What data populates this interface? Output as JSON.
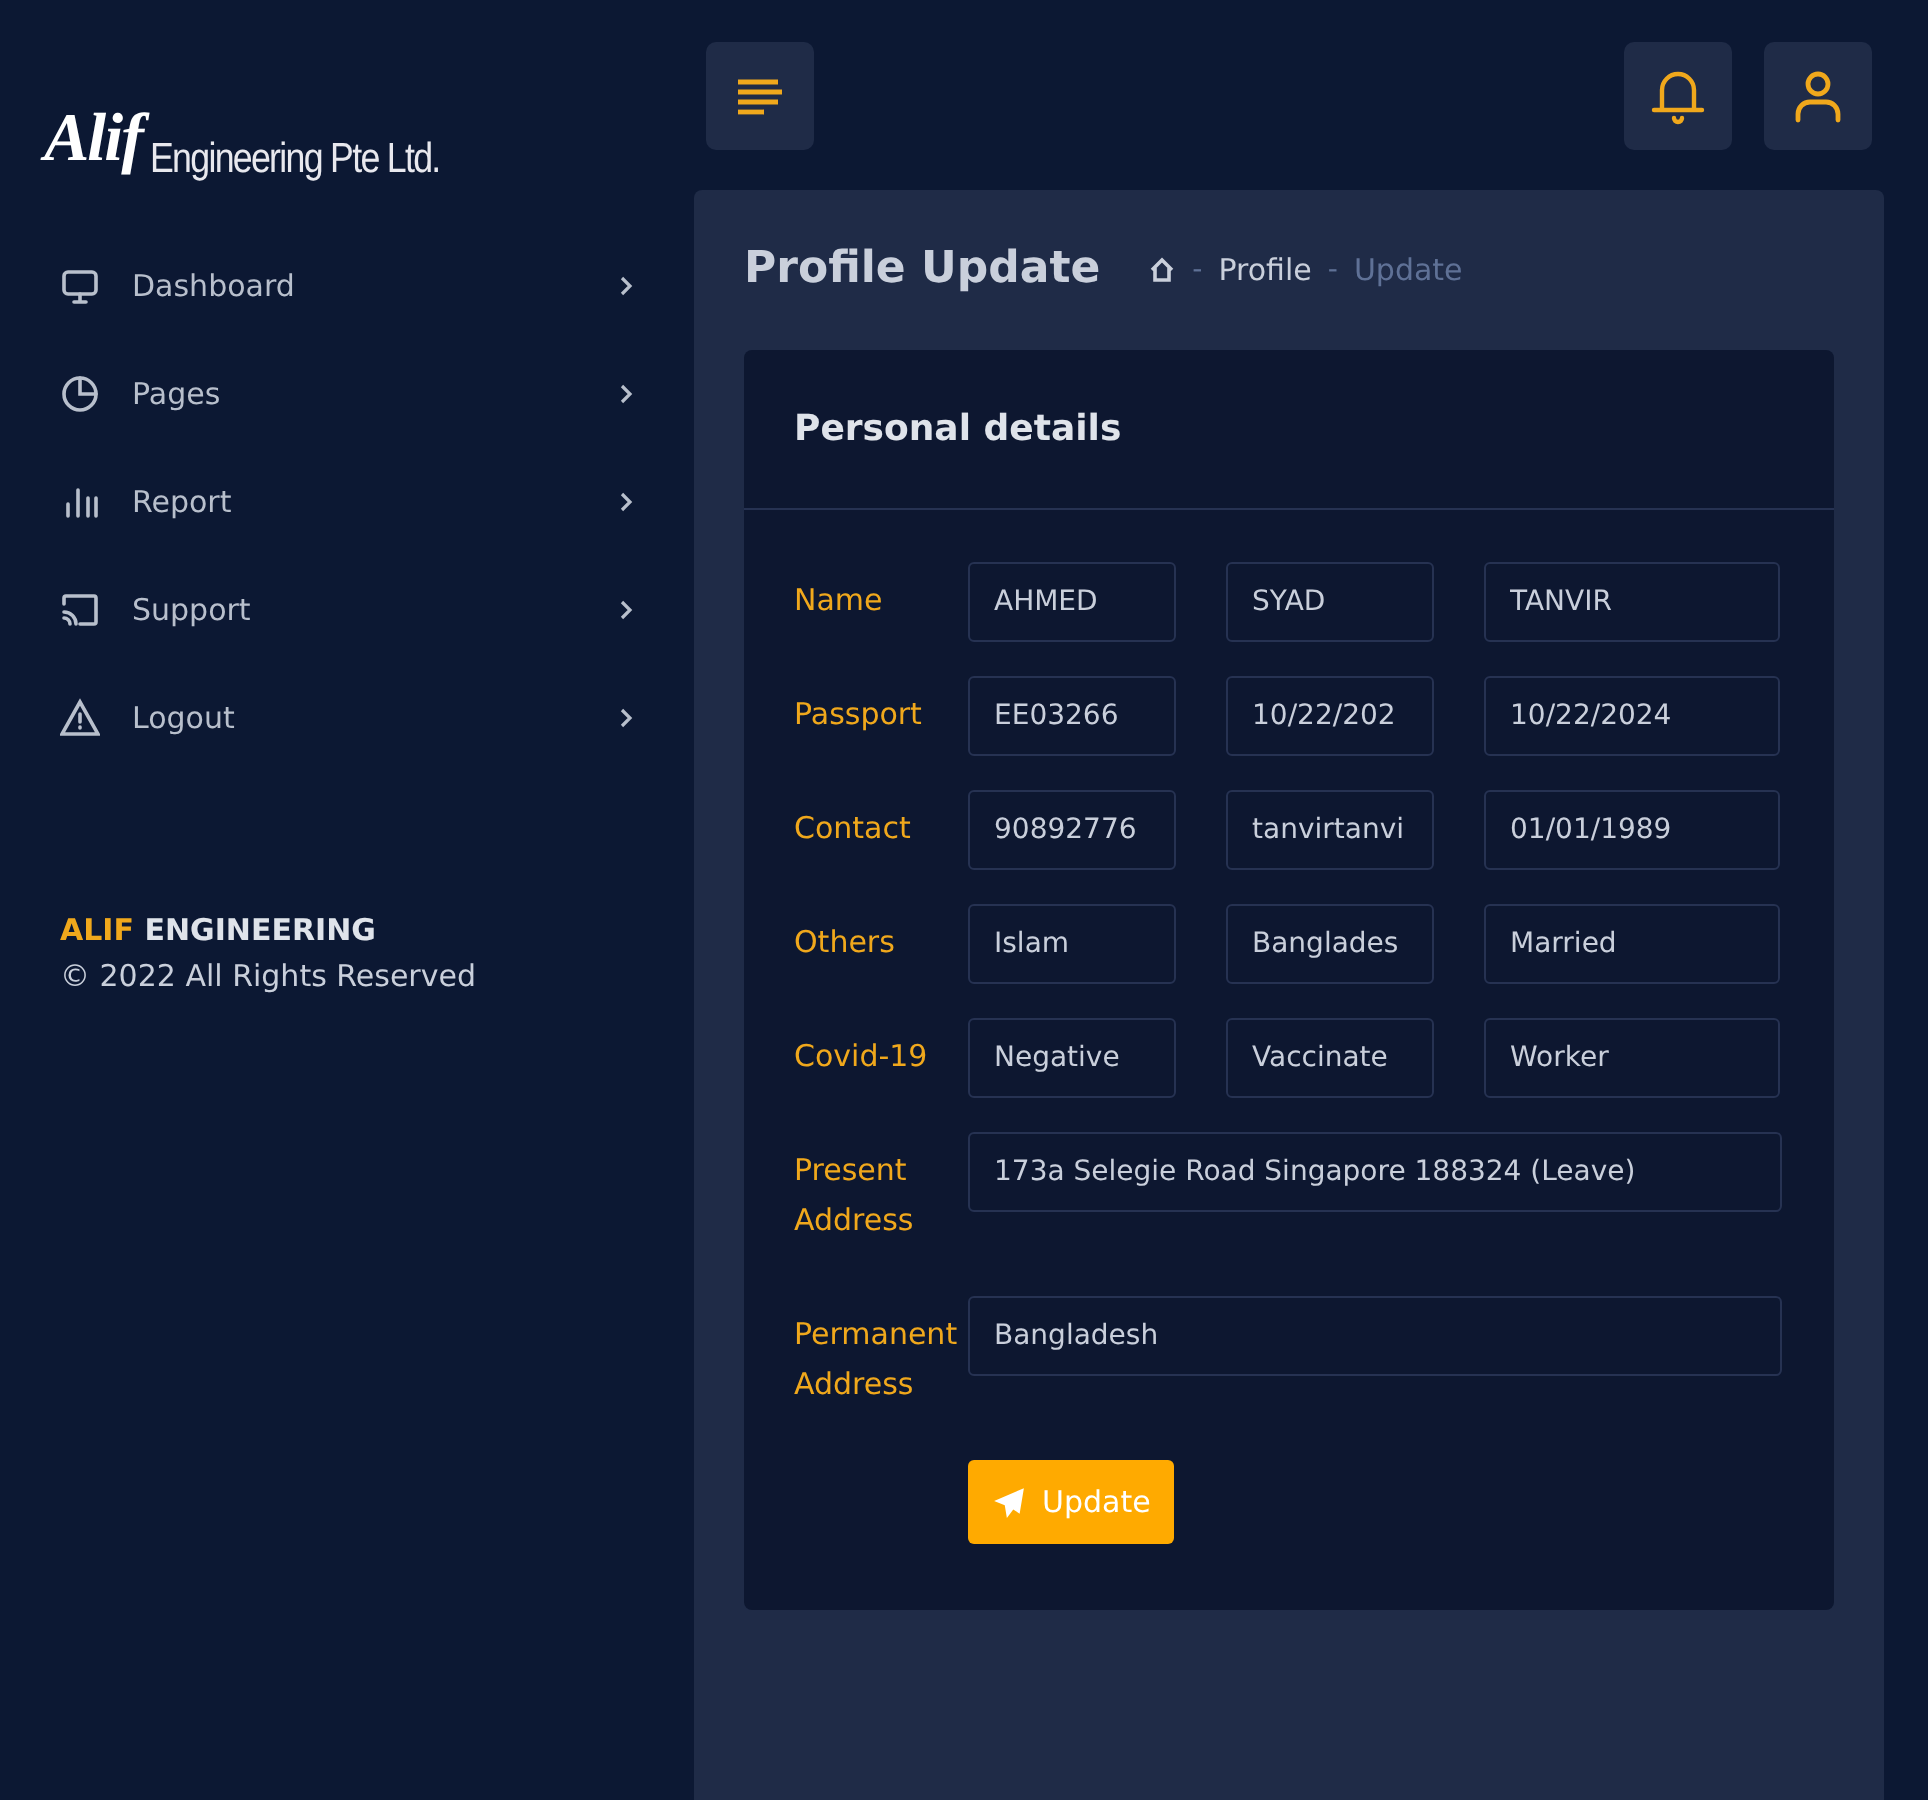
{
  "logo": {
    "mark": "Alif",
    "text": "Engineering Pte Ltd."
  },
  "sidebar": {
    "items": [
      {
        "label": "Dashboard"
      },
      {
        "label": "Pages"
      },
      {
        "label": "Report"
      },
      {
        "label": "Support"
      },
      {
        "label": "Logout"
      }
    ],
    "footer": {
      "brand_accent": "ALIF",
      "brand_rest": "ENGINEERING",
      "copyright": "© 2022 All Rights Reserved"
    }
  },
  "page": {
    "title": "Profile Update",
    "breadcrumb": [
      {
        "separator": "-",
        "label": "Profile",
        "selected": false
      },
      {
        "separator": "-",
        "label": "Update",
        "selected": true
      }
    ]
  },
  "card": {
    "title": "Personal details",
    "rows": [
      {
        "label": "Name",
        "kind": "triple",
        "values": [
          "AHMED",
          "SYAD",
          "TANVIR"
        ]
      },
      {
        "label": "Passport",
        "kind": "triple",
        "values": [
          "EE03266",
          "10/22/202",
          "10/22/2024"
        ]
      },
      {
        "label": "Contact",
        "kind": "triple",
        "values": [
          "90892776",
          "tanvirtanvi",
          "01/01/1989"
        ]
      },
      {
        "label": "Others",
        "kind": "triple",
        "values": [
          "Islam",
          "Banglades",
          "Married"
        ]
      },
      {
        "label": "Covid-19",
        "kind": "triple",
        "values": [
          "Negative",
          "Vaccinate",
          "Worker"
        ]
      },
      {
        "label": "Present Address",
        "kind": "wide",
        "values": [
          "173a Selegie Road Singapore 188324 (Leave)"
        ]
      },
      {
        "label": "Permanent Address",
        "kind": "wide",
        "values": [
          "Bangladesh"
        ]
      }
    ],
    "button": "Update"
  }
}
